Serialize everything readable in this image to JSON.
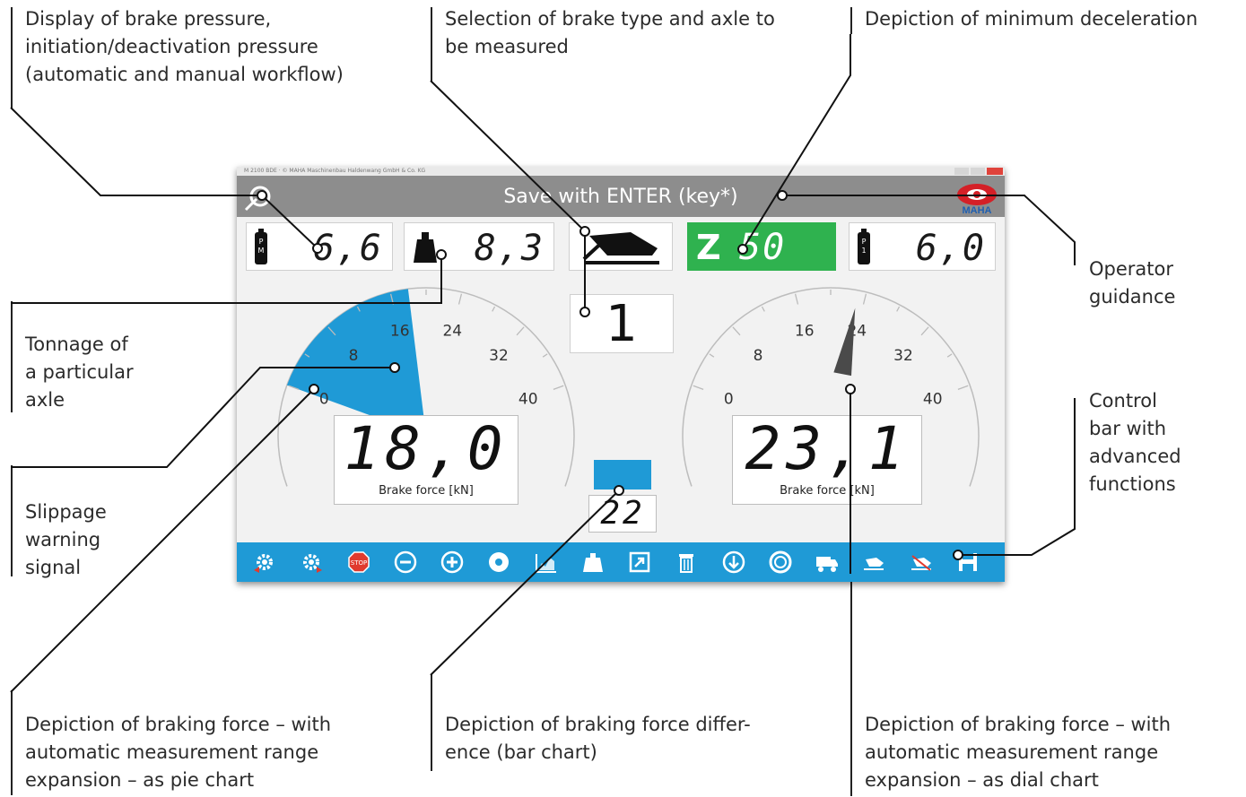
{
  "callouts": {
    "brake_pressure": [
      "Display of brake pressure,",
      "initiation/deactivation pressure",
      "(automatic and manual workflow)"
    ],
    "brake_type": [
      "Selection of brake type and axle to",
      "be measured"
    ],
    "min_decel": [
      "Depiction of minimum deceleration"
    ],
    "operator": [
      "Operator",
      "guidance"
    ],
    "tonnage": [
      "Tonnage of",
      "a particular",
      "axle"
    ],
    "control_bar": [
      "Control",
      "bar with",
      "advanced",
      "functions"
    ],
    "slippage": [
      "Slippage",
      "warning",
      "signal"
    ],
    "pie_chart": [
      "Depiction of braking force – with",
      "automatic measurement range",
      "expansion – as pie chart"
    ],
    "bar_chart": [
      "Depiction of braking force differ-",
      "ence (bar chart)"
    ],
    "dial_chart": [
      "Depiction of braking force – with",
      "automatic measurement range",
      "expansion – as dial chart"
    ]
  },
  "window": {
    "titlebar_text": "M 2100 BDE · © MAHA Maschinenbau Haldenwang GmbH & Co. KG",
    "header_text": "Save with ENTER (key*)",
    "pm_value": "6,6",
    "weight_value": "8,3",
    "z_label": "Z",
    "z_value": "50",
    "p1_value": "6,0",
    "axle_number": "1",
    "bottle_pm_letters": [
      "P",
      "M"
    ],
    "bottle_p1_letters": [
      "P",
      "1"
    ],
    "logo_text": "MAHA"
  },
  "gauge_left": {
    "ticks": [
      "0",
      "8",
      "16",
      "24",
      "32",
      "40"
    ],
    "readout": "18,0",
    "unit": "Brake force [kN]",
    "value": 18.0
  },
  "gauge_right": {
    "ticks": [
      "0",
      "8",
      "16",
      "24",
      "32",
      "40"
    ],
    "readout": "23,1",
    "unit": "Brake force [kN]",
    "value": 23.1
  },
  "difference": {
    "readout": "22",
    "value": 22
  },
  "toolbar": {
    "icons": [
      "settings-left-icon",
      "settings-right-icon",
      "stop-icon",
      "minus-icon",
      "plus-icon",
      "disc-icon",
      "chart-icon",
      "weight-icon",
      "export-icon",
      "trash-icon",
      "download-icon",
      "tire-icon",
      "truck-icon",
      "brake-pedal-icon",
      "brake-pedal-2-icon",
      "save-icon"
    ],
    "stop_text": "STOP"
  },
  "colors": {
    "accent_blue": "#1f9ad6",
    "header_gray": "#8d8d8d",
    "z_green": "#2fb24f",
    "needle": "#4a4a4a"
  }
}
